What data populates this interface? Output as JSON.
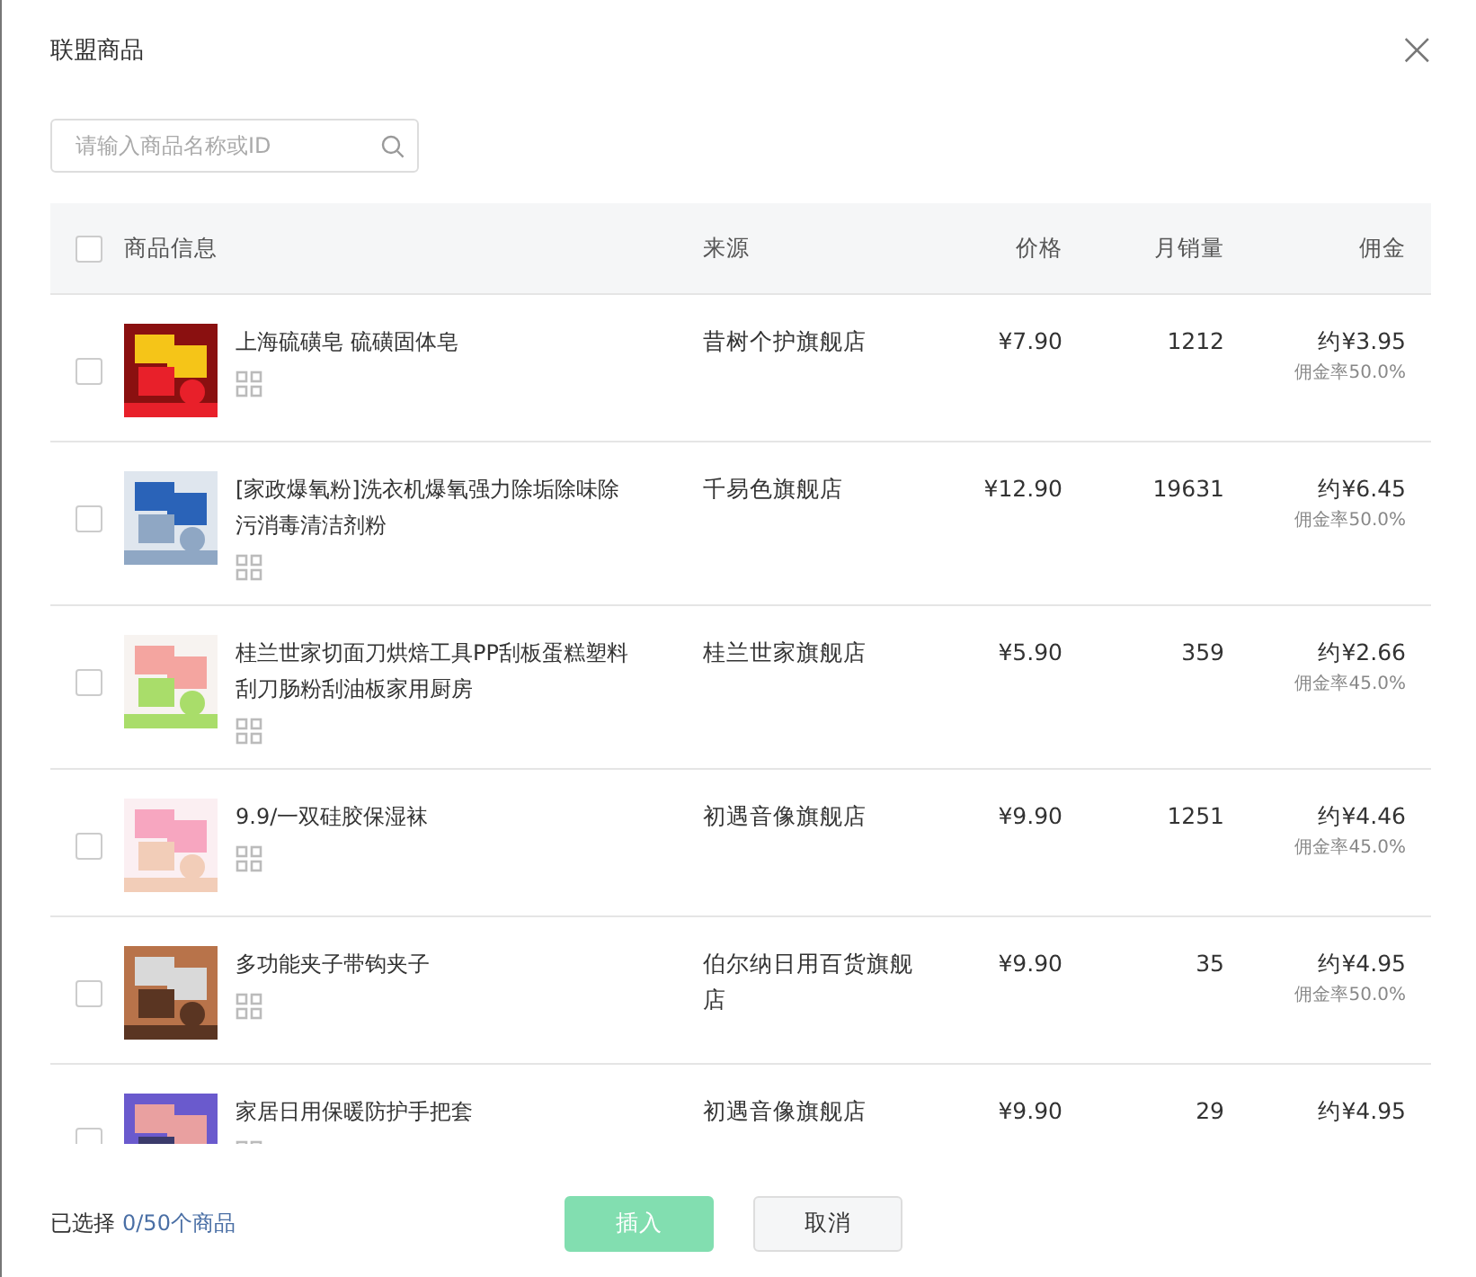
{
  "dialog": {
    "title": "联盟商品",
    "close": "×"
  },
  "search": {
    "placeholder": "请输入商品名称或ID"
  },
  "table": {
    "select_all": {
      "checked": false
    },
    "columns": [
      "商品信息",
      "来源",
      "价格",
      "月销量",
      "佣金"
    ],
    "rows": [
      {
        "checked": false,
        "name": "上海硫磺皂 硫磺固体皂",
        "source": "昔树个护旗舰店",
        "price": "¥7.90",
        "sales": "1212",
        "commission": "约¥3.95",
        "rate": "佣金率50.0%"
      },
      {
        "checked": false,
        "name": "[家政爆氧粉]洗衣机爆氧强力除垢除味除污消毒清洁剂粉",
        "source": "千易色旗舰店",
        "price": "¥12.90",
        "sales": "19631",
        "commission": "约¥6.45",
        "rate": "佣金率50.0%"
      },
      {
        "checked": false,
        "name": "桂兰世家切面刀烘焙工具PP刮板蛋糕塑料刮刀肠粉刮油板家用厨房",
        "source": "桂兰世家旗舰店",
        "price": "¥5.90",
        "sales": "359",
        "commission": "约¥2.66",
        "rate": "佣金率45.0%"
      },
      {
        "checked": false,
        "name": "9.9/一双硅胶保湿袜",
        "source": "初遇音像旗舰店",
        "price": "¥9.90",
        "sales": "1251",
        "commission": "约¥4.46",
        "rate": "佣金率45.0%"
      },
      {
        "checked": false,
        "name": "多功能夹子带钩夹子",
        "source": "伯尔纳日用百货旗舰店",
        "price": "¥9.90",
        "sales": "35",
        "commission": "约¥4.95",
        "rate": "佣金率50.0%"
      },
      {
        "checked": false,
        "name": "家居日用保暖防护手把套",
        "source": "初遇音像旗舰店",
        "price": "¥9.90",
        "sales": "29",
        "commission": "约¥4.95"
      }
    ]
  },
  "footer": {
    "selected_label": "已选择",
    "selected_count": "0/50个商品",
    "buttons": [
      {
        "label": "插入",
        "kind": "primary",
        "disabled": true
      },
      {
        "label": "取消",
        "kind": "default",
        "disabled": false
      }
    ]
  }
}
